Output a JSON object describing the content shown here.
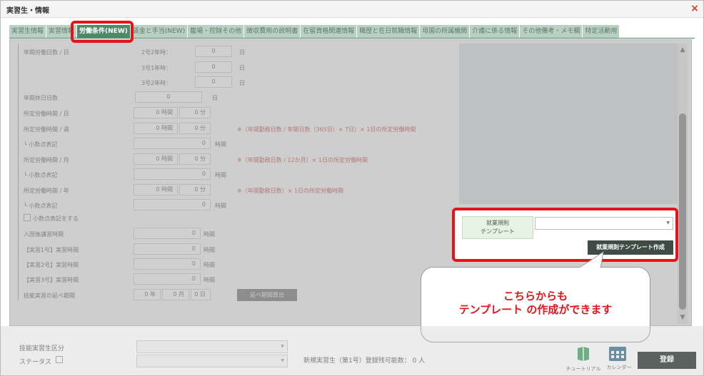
{
  "window": {
    "title": "実習生・情報",
    "close": "×"
  },
  "tabs": [
    {
      "label": "実習生情報"
    },
    {
      "label": "実習情報"
    },
    {
      "label": "労働条件(NEW)"
    },
    {
      "label": "賃金と手当(NEW)"
    },
    {
      "label": "籠場・控除その他"
    },
    {
      "label": "徴収費用の説明書"
    },
    {
      "label": "在留資格関連情報"
    },
    {
      "label": "職歴と在日就職情報"
    },
    {
      "label": "母国の所属機関"
    },
    {
      "label": "介護に係る情報"
    },
    {
      "label": "その他備考・メモ欄"
    },
    {
      "label": "特定活動用"
    }
  ],
  "form": {
    "annual_days": {
      "label": "年間労働日数 / 日",
      "unit": "日",
      "rows": [
        {
          "label": "2号2年時：",
          "value": "0"
        },
        {
          "label": "3号1年時：",
          "value": "0"
        },
        {
          "label": "3号2年時：",
          "value": "0"
        }
      ]
    },
    "annual_holidays": {
      "label": "年間休日日数",
      "value": "0",
      "unit": "日"
    },
    "weekly_day": {
      "label": "所定労働時間 / 日",
      "hours": "0",
      "hours_unit": "時間",
      "minutes": "0",
      "minutes_unit": "分"
    },
    "week": {
      "label": "所定労働時間 / 週",
      "hours": "0",
      "hours_unit": "時間",
      "minutes": "0",
      "minutes_unit": "分",
      "note": "※（年間勤務日数 / 年間日数（365日）× 7日）× 1日の所定労働時間",
      "decimal_label": "└ 小数点表記",
      "decimal_value": "0",
      "decimal_unit": "時間"
    },
    "month": {
      "label": "所定労働時間 / 月",
      "hours": "0",
      "hours_unit": "時間",
      "minutes": "0",
      "minutes_unit": "分",
      "note": "※（年間勤務日数 / 12か月）× 1日の所定労働時間",
      "decimal_label": "└ 小数点表記",
      "decimal_value": "0",
      "decimal_unit": "時間"
    },
    "year": {
      "label": "所定労働時間 / 年",
      "hours": "0",
      "hours_unit": "時間",
      "minutes": "0",
      "minutes_unit": "分",
      "note": "※（年間勤務日数）× 1日の所定労働時間",
      "decimal_label": "└ 小数点表記",
      "decimal_value": "0",
      "decimal_unit": "時間"
    },
    "use_decimal": {
      "label": "小数点表記をする"
    },
    "hours_rows": [
      {
        "label": "入国後講習時間",
        "value": "0",
        "unit": "時間"
      },
      {
        "label": "【実習1号】実習時間",
        "value": "0",
        "unit": "時間"
      },
      {
        "label": "【実習2号】実習時間",
        "value": "0",
        "unit": "時間"
      },
      {
        "label": "【実習3号】実習時間",
        "value": "0",
        "unit": "時間"
      }
    ],
    "total_period": {
      "label": "技能実習の延べ期間",
      "year": "0",
      "year_unit": "年",
      "month": "0",
      "month_unit": "月",
      "day": "0",
      "day_unit": "日",
      "button": "延べ期間算出"
    }
  },
  "template": {
    "label_line1": "就業規則",
    "label_line2": "テンプレート",
    "select_value": "",
    "button": "就業規則テンプレート作成"
  },
  "callout": {
    "line1": "こちらからも",
    "line2": "テンプレート の作成ができます"
  },
  "footer": {
    "category_label": "技能実習生区分",
    "status_label": "ステータス",
    "registrable": "新規実習生（第1号）登録残可能数： 0 人",
    "tutorial": "チュートリアル",
    "calendar": "カレンダー",
    "register": "登録"
  },
  "colors": {
    "accent": "#4f8a68",
    "highlight": "#e5141b",
    "note": "#c03c3c"
  }
}
